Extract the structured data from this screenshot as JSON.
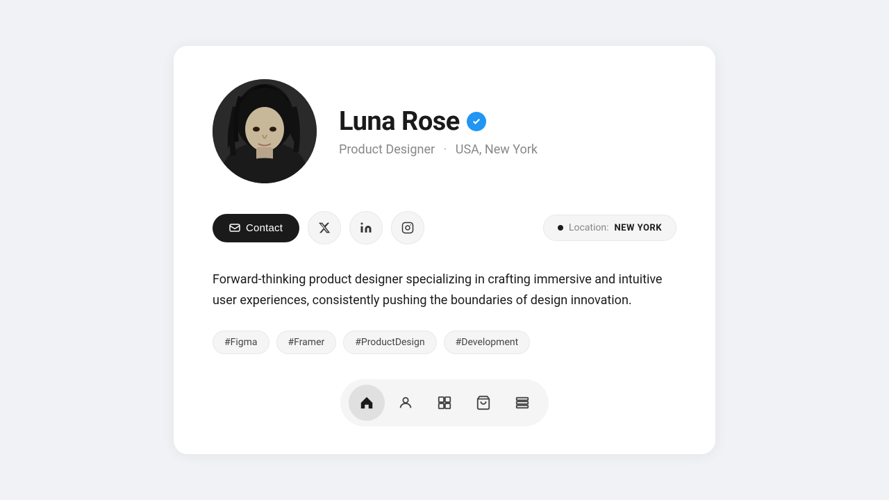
{
  "profile": {
    "name": "Luna Rose",
    "verified": true,
    "title": "Product Designer",
    "location_display": "USA, New York",
    "location_badge": "NEW YORK",
    "bio": "Forward-thinking product designer specializing in crafting immersive and intuitive user experiences, consistently pushing the boundaries of design innovation.",
    "tags": [
      "#Figma",
      "#Framer",
      "#ProductDesign",
      "#Development"
    ]
  },
  "actions": {
    "contact_label": "Contact",
    "location_label": "Location:"
  },
  "nav": {
    "items": [
      "home",
      "profile",
      "grid",
      "cart",
      "list"
    ]
  }
}
